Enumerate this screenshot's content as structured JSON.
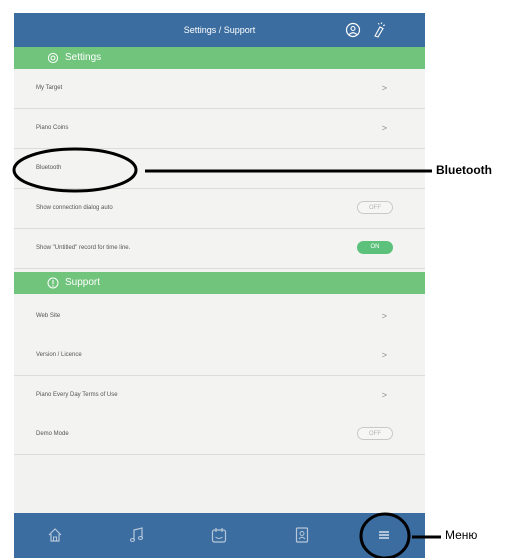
{
  "header": {
    "title": "Settings / Support",
    "icons": [
      "user-icon",
      "wand-icon"
    ]
  },
  "settings_section": {
    "label": "Settings",
    "rows": [
      {
        "label": "My Target",
        "control": "chevron"
      },
      {
        "label": "Piano Coins",
        "control": "chevron"
      },
      {
        "label": "Bluetooth",
        "control": "none"
      },
      {
        "label": "Show connection dialog auto",
        "control": "toggle",
        "toggle_text": "OFF",
        "state": "off"
      },
      {
        "label": "Show \"Untitled\" record for time line.",
        "control": "toggle",
        "toggle_text": "ON",
        "state": "on"
      }
    ]
  },
  "support_section": {
    "label": "Support",
    "rows": [
      {
        "label": "Web Site",
        "control": "chevron"
      },
      {
        "label": "Version / Licence",
        "control": "chevron"
      },
      {
        "label": "Piano Every Day Terms of Use",
        "control": "chevron"
      },
      {
        "label": "Demo Mode",
        "control": "toggle",
        "toggle_text": "OFF",
        "state": "off"
      }
    ]
  },
  "chevron_glyph": ">",
  "tabbar": {
    "icons": [
      "home-icon",
      "music-note-icon",
      "calendar-icon",
      "diary-icon",
      "menu-icon"
    ]
  },
  "callouts": {
    "bluetooth": "Bluetooth",
    "menu": "Меню"
  },
  "colors": {
    "header": "#3b6da0",
    "section": "#70c47c",
    "toggle_on": "#5cc17a"
  }
}
